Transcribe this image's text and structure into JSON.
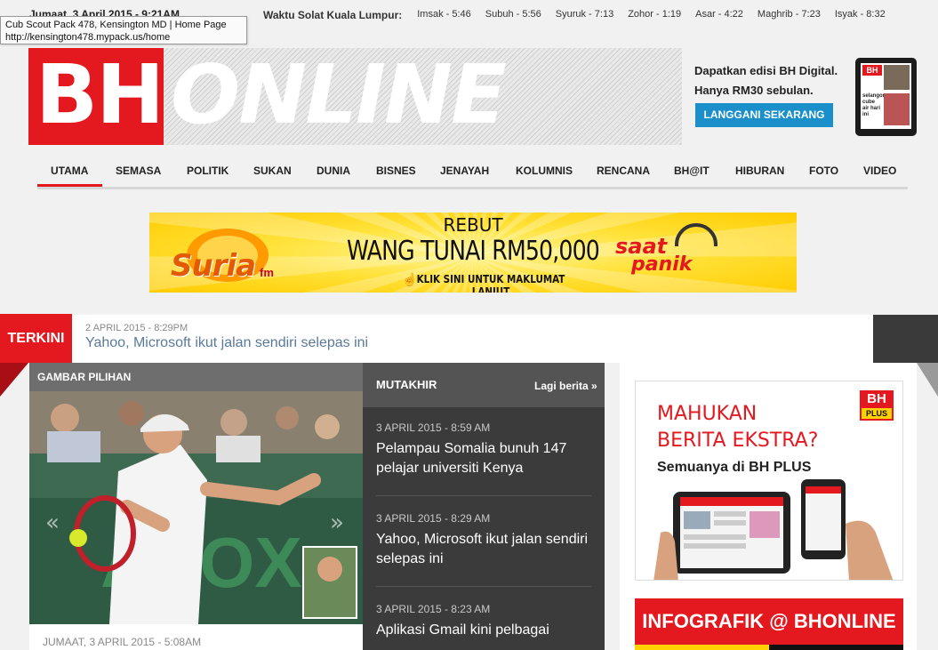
{
  "topbar": {
    "date": "Jumaat, 3 April 2015 - 9:21AM",
    "prayer_title": "Waktu Solat Kuala Lumpur:",
    "prayer_times": [
      "Imsak - 5:46",
      "Subuh - 5:56",
      "Syuruk - 7:13",
      "Zohor - 1:19",
      "Asar - 4:22",
      "Maghrib - 7:23",
      "Isyak - 8:32"
    ]
  },
  "tooltip": {
    "line1": "Cub Scout Pack 478, Kensington MD | Home Page",
    "line2": "http://kensington478.mypack.us/home"
  },
  "logo": {
    "part1": "BH",
    "part2": "ONLINE"
  },
  "promo": {
    "line1": "Dapatkan edisi BH Digital.",
    "line2": "Hanya RM30 sebulan.",
    "button": "LANGGANI SEKARANG"
  },
  "nav": {
    "items": [
      "UTAMA",
      "SEMASA",
      "POLITIK",
      "SUKAN",
      "DUNIA",
      "BISNES",
      "JENAYAH",
      "KOLUMNIS",
      "RENCANA",
      "BH@IT",
      "HIBURAN",
      "FOTO",
      "VIDEO"
    ],
    "active": "UTAMA",
    "accent": "#e3191f"
  },
  "banner": {
    "brand": "Suria",
    "brand_suffix": "fm",
    "line1": "REBUT",
    "line2": "WANG TUNAI RM50,000",
    "line3": "KLIK SINI UNTUK MAKLUMAT LANJUT",
    "tag1": "saat",
    "tag2": "panik"
  },
  "terkini": {
    "label": "TERKINI",
    "time": "2 APRIL 2015 - 8:29PM",
    "headline": "Yahoo, Microsoft ikut jalan sendiri selepas ini"
  },
  "gambar_pilihan": {
    "title": "GAMBAR PILIHAN",
    "date": "JUMAAT, 3 APRIL 2015 - 5:08AM",
    "prev": "«",
    "next": "»"
  },
  "mutakhir": {
    "title": "MUTAKHIR",
    "more": "Lagi berita »",
    "items": [
      {
        "time": "3 APRIL 2015 - 8:59 AM",
        "title": "Pelampau Somalia bunuh 147 pelajar universiti Kenya"
      },
      {
        "time": "3 APRIL 2015 - 8:29 AM",
        "title": "Yahoo, Microsoft ikut jalan sendiri selepas ini"
      },
      {
        "time": "3 APRIL 2015 - 8:23 AM",
        "title": "Aplikasi Gmail kini pelbagai"
      }
    ]
  },
  "bhplus_ad": {
    "badge_top": "BH",
    "badge_bottom": "PLUS",
    "headline1": "MAHUKAN",
    "headline2": "BERITA EKSTRA?",
    "sub": "Semuanya di BH PLUS"
  },
  "infografik": {
    "label": "INFOGRAFIK @ BHONLINE"
  },
  "tablet": {
    "caption": "selangor cube air hari ini"
  }
}
